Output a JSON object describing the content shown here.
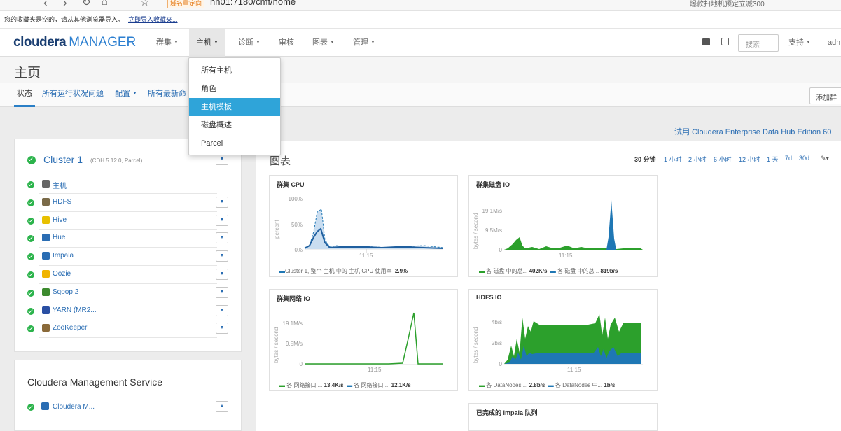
{
  "browser": {
    "warning_badge": "域名重定向",
    "url": "hh01:7180/cmf/home",
    "search_text": "爆款扫地机预定立减300"
  },
  "bookmarks": {
    "message": "您的收藏夹是空的，请从其他浏览器导入。",
    "import_link": "立即导入收藏夹..."
  },
  "topnav": {
    "logo_main": "cloudera",
    "logo_sub": "MANAGER",
    "items": [
      "群集",
      "主机",
      "诊断",
      "审核",
      "图表",
      "管理"
    ],
    "search_placeholder": "搜索",
    "support": "支持",
    "user": "adm"
  },
  "page": {
    "title": "主页"
  },
  "tabs": [
    "状态",
    "所有运行状况问题",
    "配置",
    "所有最新命"
  ],
  "add_cluster": "添加群",
  "trial_text": "试用 Cloudera Enterprise Data Hub Edition 60",
  "host_menu": [
    "所有主机",
    "角色",
    "主机模板",
    "磁盘概述",
    "Parcel"
  ],
  "cluster": {
    "name": "Cluster 1",
    "version": "(CDH 5.12.0, Parcel)",
    "services": [
      {
        "name": "主机",
        "icon": "list-icon",
        "color": "#666666"
      },
      {
        "name": "HDFS",
        "icon": "hdfs-icon",
        "color": "#7a6a48"
      },
      {
        "name": "Hive",
        "icon": "hive-icon",
        "color": "#e8c000"
      },
      {
        "name": "Hue",
        "icon": "hue-icon",
        "color": "#2a6db3"
      },
      {
        "name": "Impala",
        "icon": "impala-icon",
        "color": "#2a6db3"
      },
      {
        "name": "Oozie",
        "icon": "oozie-icon",
        "color": "#f0b400"
      },
      {
        "name": "Sqoop 2",
        "icon": "sqoop-icon",
        "color": "#3c8a2e"
      },
      {
        "name": "YARN (MR2...",
        "icon": "yarn-icon",
        "color": "#2a4fa3"
      },
      {
        "name": "ZooKeeper",
        "icon": "zookeeper-icon",
        "color": "#8a6a3a"
      }
    ]
  },
  "mgmt": {
    "title": "Cloudera Management Service",
    "service": "Cloudera M..."
  },
  "charts_section": {
    "title": "图表",
    "time_ranges": [
      "30 分钟",
      "1 小时",
      "2 小时",
      "6 小时",
      "12 小时",
      "1 天",
      "7d",
      "30d"
    ]
  },
  "charts": [
    {
      "title": "群集 CPU",
      "ylabel": "percent",
      "yticks": [
        "100%",
        "50%",
        "0%"
      ],
      "xtick": "11:15",
      "legend": "Cluster 1, 整个 主机 中的 主机 CPU 使用率",
      "legend_value": "2.9%"
    },
    {
      "title": "群集磁盘 IO",
      "ylabel": "bytes / second",
      "yticks": [
        "19.1M/s",
        "9.5M/s",
        "0"
      ],
      "xtick": "11:15",
      "legend": "各 磁盘 中的总...",
      "legend_value": "402K/s",
      "legend2": "各 磁盘 中的总...",
      "legend2_value": "819b/s"
    },
    {
      "title": "群集网络 IO",
      "ylabel": "bytes / second",
      "yticks": [
        "19.1M/s",
        "9.5M/s",
        "0"
      ],
      "xtick": "11:15",
      "legend": "各 网络接口 ...",
      "legend_value": "13.4K/s",
      "legend2": "各 网络接口 ...",
      "legend2_value": "12.1K/s"
    },
    {
      "title": "HDFS IO",
      "ylabel": "bytes / second",
      "yticks": [
        "4b/s",
        "2b/s",
        "0"
      ],
      "xtick": "11:15",
      "legend": "各 DataNodes ...",
      "legend_value": "2.8b/s",
      "legend2": "各 DataNodes 中...",
      "legend2_value": "1b/s"
    },
    {
      "title": "已完成的 Impala 队列"
    }
  ],
  "colors": {
    "green": "#2bb34b",
    "blue": "#1f77b4",
    "accent": "#2fa4d9"
  }
}
